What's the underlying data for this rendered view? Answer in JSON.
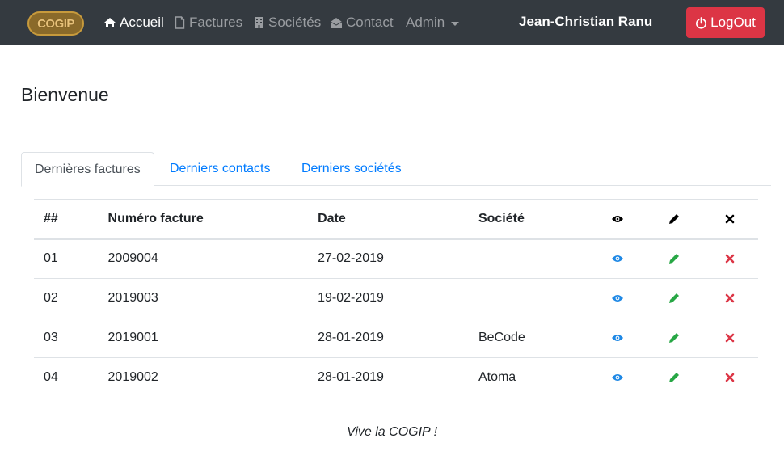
{
  "nav": {
    "logo_text": "COGIP",
    "items": [
      {
        "label": "Accueil",
        "icon": "home-icon"
      },
      {
        "label": "Factures",
        "icon": "file-icon"
      },
      {
        "label": "Sociétés",
        "icon": "building-icon"
      },
      {
        "label": "Contact",
        "icon": "envelope-open-icon"
      },
      {
        "label": "Admin",
        "icon": "chevron-down-icon"
      }
    ],
    "user": "Jean-Christian Ranu",
    "logout": "LogOut"
  },
  "page": {
    "title": "Bienvenue"
  },
  "tabs": [
    {
      "label": "Dernières factures",
      "active": true
    },
    {
      "label": "Derniers contacts",
      "active": false
    },
    {
      "label": "Derniers sociétés",
      "active": false
    }
  ],
  "table": {
    "headers": [
      "##",
      "Numéro facture",
      "Date",
      "Société"
    ],
    "header_icons": [
      "eye-icon",
      "pencil-icon",
      "times-icon"
    ],
    "rows": [
      {
        "num": "01",
        "facture": "2009004",
        "date": "27-02-2019",
        "societe": ""
      },
      {
        "num": "02",
        "facture": "2019003",
        "date": "19-02-2019",
        "societe": ""
      },
      {
        "num": "03",
        "facture": "2019001",
        "date": "28-01-2019",
        "societe": "BeCode"
      },
      {
        "num": "04",
        "facture": "2019002",
        "date": "28-01-2019",
        "societe": "Atoma"
      }
    ]
  },
  "colors": {
    "navbar": "#343a40",
    "danger": "#dc3545",
    "link": "#007bff",
    "success": "#28a745",
    "info": "#1e88e5"
  },
  "footer": "Vive la COGIP !"
}
